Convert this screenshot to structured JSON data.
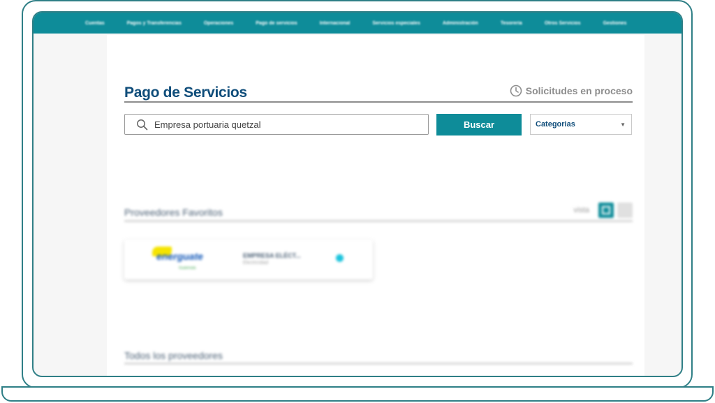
{
  "nav": {
    "items": [
      "Cuentas",
      "Pagos y Transferencias",
      "Operaciones",
      "Pago de servicios",
      "Internacional",
      "Servicios especiales",
      "Administración",
      "Tesorería",
      "Otros Servicios",
      "Gestiones"
    ]
  },
  "header": {
    "title": "Pago de Servicios",
    "pending_label": "Solicitudes en proceso"
  },
  "search": {
    "value": "Empresa portuaria quetzal",
    "button_label": "Buscar",
    "category_label": "Categorias"
  },
  "favorites": {
    "title": "Proveedores Favoritos",
    "view_label": "vista",
    "cards": [
      {
        "logo_text": "energuate",
        "logo_sub": "Guatemala",
        "name": "EMPRESA ELÉCT...",
        "category": "Electricidad"
      }
    ]
  },
  "all_providers": {
    "title": "Todos los proveedores"
  },
  "colors": {
    "primary": "#0e8c99",
    "title": "#0f4d7a",
    "frame": "#2f7f86",
    "status_dot": "#1cc4dd"
  }
}
